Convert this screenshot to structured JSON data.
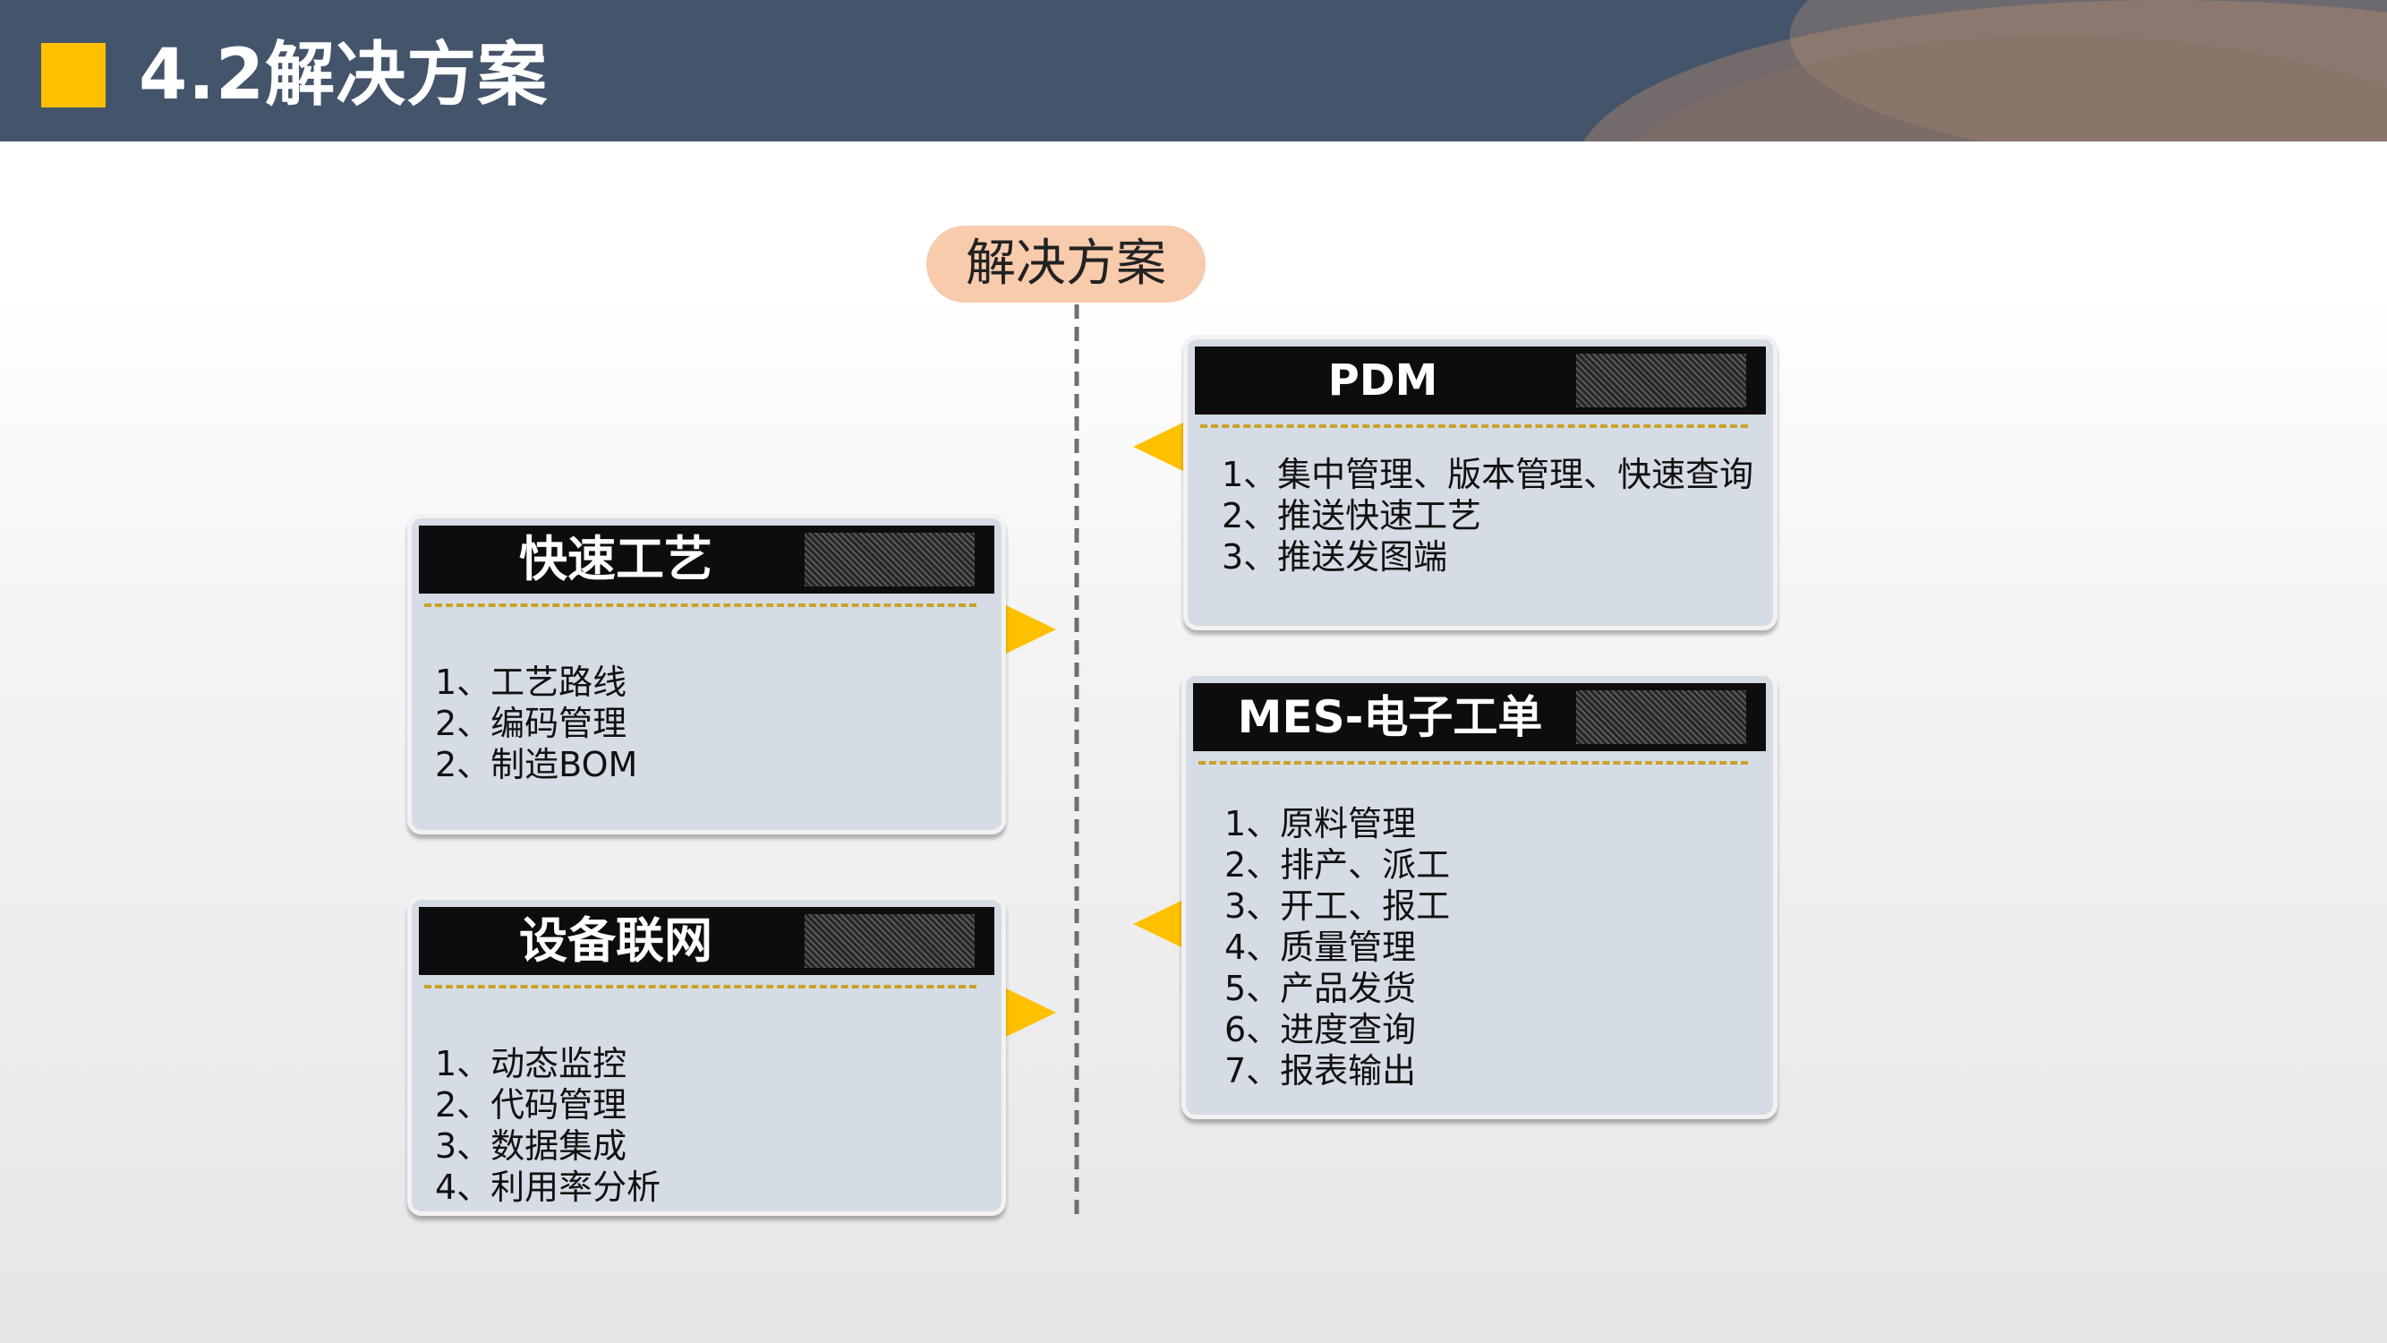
{
  "page": {
    "title": "4.2解决方案"
  },
  "center": {
    "label": "解决方案"
  },
  "colors": {
    "header": "#44546a",
    "accent": "#ffc000",
    "pill": "#f8cbad",
    "card": "#d6dce5",
    "card_head": "#0d0d0d",
    "dash": "#c9a227"
  },
  "cards": {
    "pdm": {
      "title": "PDM",
      "items": [
        "1、集中管理、版本管理、快速查询",
        "2、推送快速工艺",
        "3、推送发图端"
      ]
    },
    "process": {
      "title": "快速工艺",
      "items": [
        "1、工艺路线",
        "2、编码管理",
        "2、制造BOM"
      ]
    },
    "mes": {
      "title": "MES-电子工单",
      "items": [
        "1、原料管理",
        "2、排产、派工",
        "3、开工、报工",
        "4、质量管理",
        "5、产品发货",
        "6、进度查询",
        "7、报表输出"
      ]
    },
    "device": {
      "title": "设备联网",
      "items": [
        "1、动态监控",
        "2、代码管理",
        "3、数据集成",
        "4、利用率分析"
      ]
    }
  }
}
